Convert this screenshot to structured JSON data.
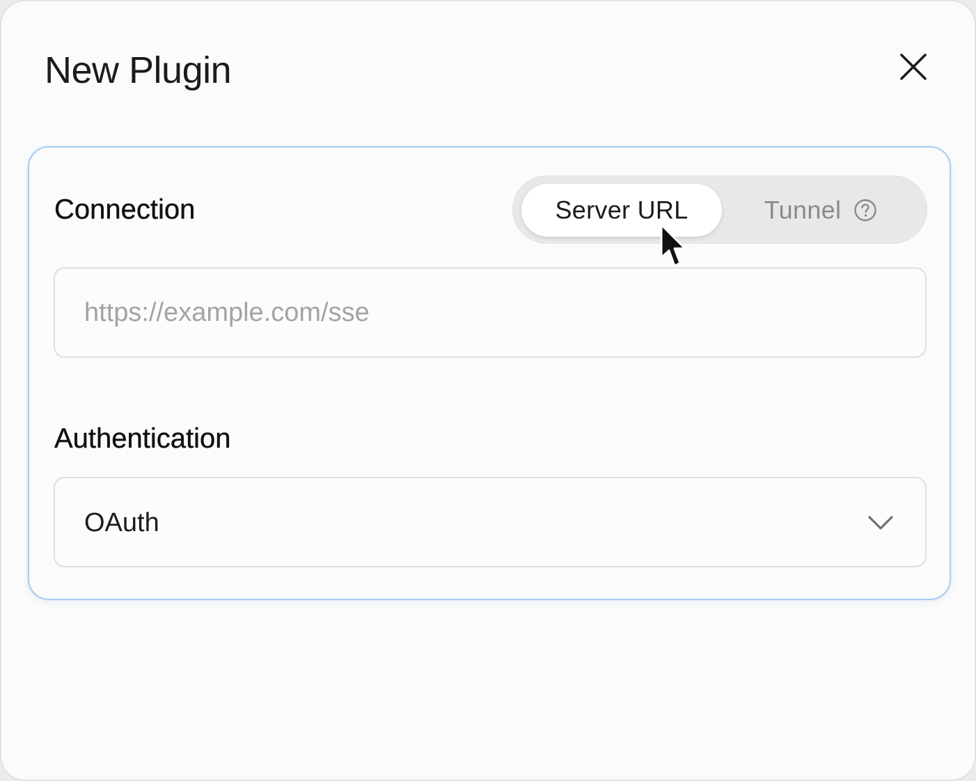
{
  "dialog": {
    "title": "New Plugin",
    "close_icon": "close-icon"
  },
  "connection": {
    "label": "Connection",
    "modes": [
      {
        "label": "Server URL",
        "selected": true
      },
      {
        "label": "Tunnel",
        "selected": false,
        "icon": "help-circle-icon"
      }
    ],
    "url_input": {
      "value": "",
      "placeholder": "https://example.com/sse"
    }
  },
  "authentication": {
    "label": "Authentication",
    "selected": "OAuth",
    "icon": "chevron-down-icon"
  },
  "colors": {
    "panel_border": "#a9cdf3",
    "segment_track": "#e8e8e8",
    "segment_active": "#ffffff",
    "inactive_text": "#8a8a8a",
    "placeholder_text": "#a3a3a3"
  }
}
